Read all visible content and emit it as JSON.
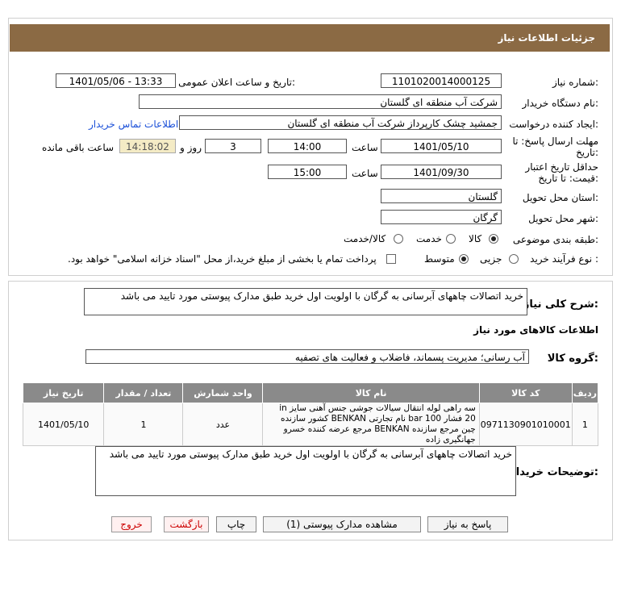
{
  "header": {
    "title": "جزئیات اطلاعات نیاز"
  },
  "fields": {
    "need_number_label": "شماره نیاز:",
    "need_number": "1101020014000125",
    "announce_label": "تاریخ و ساعت اعلان عمومی:",
    "announce_value": "1401/05/06 - 13:33",
    "buyer_org_label": "نام دستگاه خریدار:",
    "buyer_org": "شرکت آب منطقه ای گلستان",
    "requester_label": "ایجاد کننده درخواست:",
    "requester": "جمشید چشک کارپرداز شرکت آب منطقه ای گلستان",
    "contact_link": "اطلاعات تماس خریدار",
    "reply_deadline_label": "مهلت ارسال پاسخ: تا",
    "reply_deadline_label2": "تاریخ:",
    "reply_date": "1401/05/10",
    "time_label": "ساعت",
    "reply_time": "14:00",
    "days_value": "3",
    "days_label": "روز و",
    "remaining_time": "14:18:02",
    "remaining_label": "ساعت باقی مانده",
    "validity_label": "حداقل تاریخ اعتبار",
    "validity_label2": "قیمت: تا تاریخ:",
    "validity_date": "1401/09/30",
    "validity_time": "15:00",
    "province_label": "استان محل تحویل:",
    "province": "گلستان",
    "city_label": "شهر محل تحویل:",
    "city": "گرگان",
    "category_label": "طبقه بندی موضوعی:",
    "cat_goods": "کالا",
    "cat_service": "خدمت",
    "cat_both": "کالا/خدمت",
    "process_label": "نوع فرآیند خرید :",
    "proc_minor": "جزیی",
    "proc_medium": "متوسط",
    "payment_note": "پرداخت تمام یا بخشی از مبلغ خرید،از محل \"اسناد خزانه اسلامی\" خواهد بود."
  },
  "summary": {
    "label": "شرح کلی نیاز:",
    "text": "خرید اتصالات چاههای آبرسانی به گرگان با اولویت اول خرید طبق مدارک پیوستی مورد تایید می باشد"
  },
  "goods_section": {
    "title": "اطلاعات کالاهای مورد نیاز",
    "group_label": "گروه کالا:",
    "group_value": "آب رسانی؛ مدیریت پسماند، فاضلاب و فعالیت های تصفیه"
  },
  "table": {
    "headers": [
      "ردیف",
      "کد کالا",
      "نام کالا",
      "واحد شمارش",
      "تعداد / مقدار",
      "تاریخ نیاز"
    ],
    "rows": [
      {
        "row": "1",
        "code": "0971130901010001",
        "name": "سه راهی لوله انتقال سیالات جوشی جنس آهنی سایز in 20 فشار bar 100 نام تجارتی BENKAN کشور سازنده چین مرجع سازنده BENKAN مرجع عرضه کننده خسرو جهانگیری زاده",
        "unit": "عدد",
        "qty": "1",
        "date": "1401/05/10"
      }
    ]
  },
  "buyer_notes": {
    "label": "توضیحات خریدار:",
    "text": "خرید اتصالات چاههای آبرسانی به گرگان با اولویت اول خرید طبق مدارک پیوستی مورد تایید می باشد"
  },
  "buttons": {
    "reply": "پاسخ به نیاز",
    "attachments": "مشاهده مدارک پیوستی (1)",
    "print": "چاپ",
    "back": "بازگشت",
    "exit": "خروج"
  },
  "watermark": {
    "brand": "ParsNamadData"
  },
  "colors": {
    "header": "#8b6a44",
    "link": "#1a4fd8",
    "table_header": "#8a8a8a"
  }
}
